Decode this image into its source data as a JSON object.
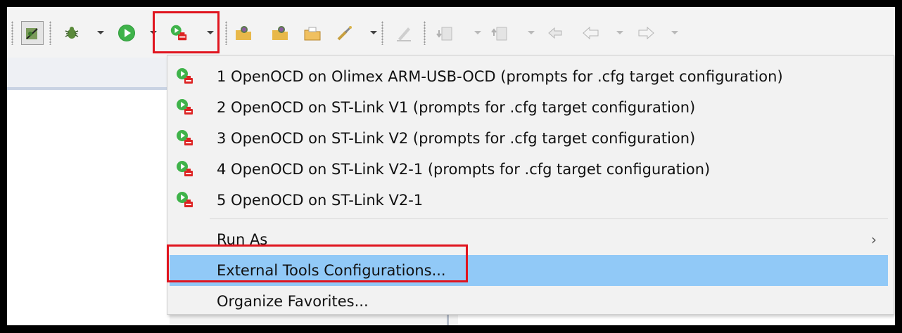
{
  "toolbar": {
    "icons": [
      "skip-breakpoints-icon",
      "debug-icon",
      "run-icon",
      "external-tools-icon",
      "open-type-icon",
      "open-task-icon",
      "open-resource-icon",
      "search-icon",
      "pen-icon",
      "next-annotation-icon",
      "prev-annotation-icon",
      "last-edit-icon",
      "back-icon",
      "forward-icon"
    ]
  },
  "menu": {
    "launch_items": [
      {
        "label": "1 OpenOCD on Olimex ARM-USB-OCD (prompts for .cfg target configuration)",
        "icon": "external-tool-launch-icon"
      },
      {
        "label": "2 OpenOCD on ST-Link V1 (prompts for .cfg target configuration)",
        "icon": "external-tool-launch-icon"
      },
      {
        "label": "3 OpenOCD on ST-Link V2 (prompts for .cfg target configuration)",
        "icon": "external-tool-launch-icon"
      },
      {
        "label": "4 OpenOCD on ST-Link V2-1 (prompts for .cfg target configuration)",
        "icon": "external-tool-launch-icon"
      },
      {
        "label": "5 OpenOCD on ST-Link V2-1",
        "icon": "external-tool-launch-icon"
      }
    ],
    "run_as": "Run As",
    "run_as_arrow": "›",
    "external_tools_configurations": "External Tools Configurations...",
    "organize_favorites": "Organize Favorites..."
  },
  "colors": {
    "selection": "#91c9f7",
    "highlight_box": "#e0141e",
    "menu_bg": "#f2f2f2"
  }
}
